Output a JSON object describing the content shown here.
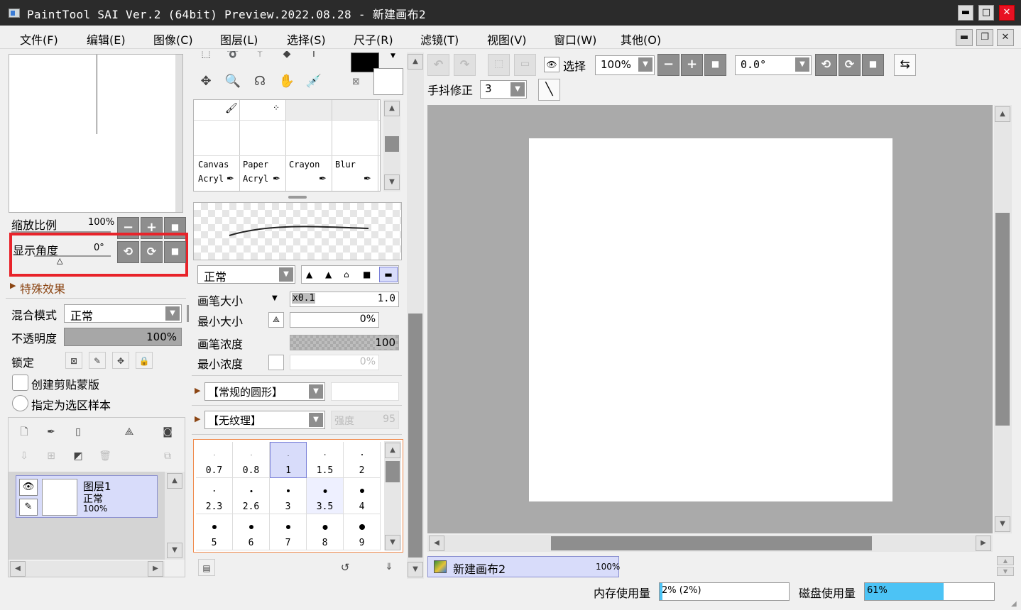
{
  "window": {
    "title": "PaintTool SAI Ver.2 (64bit) Preview.2022.08.28 - 新建画布2",
    "min_label": "▬",
    "max_label": "□",
    "close_label": "✕"
  },
  "menu": {
    "items": [
      "文件(F)",
      "编辑(E)",
      "图像(C)",
      "图层(L)",
      "选择(S)",
      "尺子(R)",
      "滤镜(T)",
      "视图(V)",
      "窗口(W)",
      "其他(O)"
    ],
    "mdi_min": "▬",
    "mdi_restore": "❐",
    "mdi_close": "✕"
  },
  "navigator": {
    "zoom_label": "缩放比例",
    "zoom_value": "100%",
    "angle_label": "显示角度",
    "angle_value": "0°",
    "highlight_color": "#e8232a"
  },
  "effects": {
    "label": "特殊效果"
  },
  "layer_props": {
    "blend_label": "混合模式",
    "blend_value": "正常",
    "opacity_label": "不透明度",
    "opacity_value": "100%",
    "lock_label": "锁定",
    "clip_label": "创建剪贴蒙版",
    "sample_label": "指定为选区样本"
  },
  "layers": [
    {
      "name": "图层1",
      "mode": "正常",
      "opacity": "100%"
    }
  ],
  "brushes": [
    {
      "line1": "Canvas",
      "line2": "Acryl"
    },
    {
      "line1": "Paper",
      "line2": "Acryl"
    },
    {
      "line1": "Crayon",
      "line2": ""
    },
    {
      "line1": "Blur",
      "line2": ""
    }
  ],
  "brush_settings": {
    "mode_value": "正常",
    "size_label": "画笔大小",
    "size_mult": "x0.1",
    "size_value": "1.0",
    "min_size_label": "最小大小",
    "min_size_value": "0%",
    "density_label": "画笔浓度",
    "density_value": "100",
    "min_density_label": "最小浓度",
    "min_density_value": "0%",
    "shape_value": "【常规的圆形】",
    "texture_value": "【无纹理】",
    "strength_label": "强度",
    "strength_value": "95"
  },
  "tip_sizes": [
    "0.7",
    "0.8",
    "1",
    "1.5",
    "2",
    "2.3",
    "2.6",
    "3",
    "3.5",
    "4",
    "5",
    "6",
    "7",
    "8",
    "9"
  ],
  "toolbar": {
    "select_label": "选择",
    "zoom_value": "100%",
    "angle_value": "0.0°",
    "stabilizer_label": "手抖修正",
    "stabilizer_value": "3"
  },
  "canvas_tab": {
    "name": "新建画布2",
    "zoom": "100%"
  },
  "status": {
    "mem_label": "内存使用量",
    "mem_value": "2% (2%)",
    "mem_fraction": 0.02,
    "disk_label": "磁盘使用量",
    "disk_value": "61%",
    "disk_fraction": 0.61,
    "disk_color": "#4cc3f5"
  },
  "colors": {
    "primary": "#000000",
    "secondary": "#ffffff",
    "selected_bg": "#d8dcfa"
  }
}
